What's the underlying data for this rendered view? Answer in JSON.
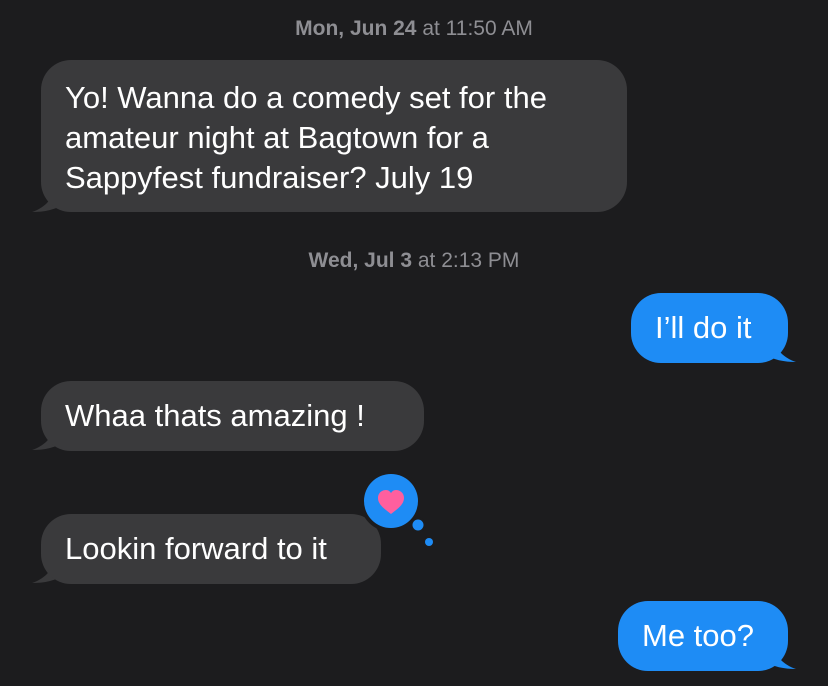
{
  "conversation": {
    "messages": [
      {
        "type": "timestamp",
        "day": "Mon, Jun 24",
        "time": "at 11:50 AM"
      },
      {
        "type": "incoming",
        "lines": [
          "Yo! Wanna do a comedy set for the",
          "amateur night at Bagtown for a",
          "Sappyfest fundraiser? July 19"
        ]
      },
      {
        "type": "timestamp",
        "day": "Wed, Jul 3",
        "time": "at 2:13 PM"
      },
      {
        "type": "outgoing",
        "lines": [
          "I’ll do it"
        ]
      },
      {
        "type": "incoming",
        "lines": [
          "Whaa thats amazing !"
        ]
      },
      {
        "type": "incoming",
        "lines": [
          "Lookin forward to it"
        ],
        "tapback": "heart-icon"
      },
      {
        "type": "outgoing",
        "lines": [
          "Me too?"
        ]
      }
    ]
  },
  "colors": {
    "background": "#1c1c1e",
    "incoming_bubble": "#3a3a3c",
    "outgoing_bubble": "#1e8cf5",
    "timestamp_text": "#8e8e93",
    "heart": "#ff5f9e"
  }
}
